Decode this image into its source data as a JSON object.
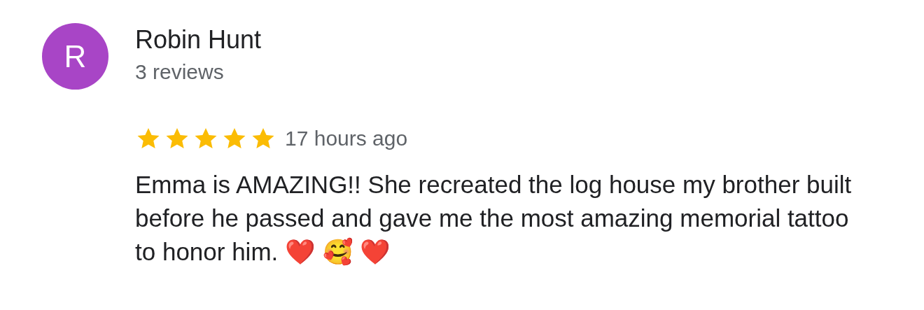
{
  "review": {
    "avatar_letter": "R",
    "author": "Robin Hunt",
    "review_count": "3 reviews",
    "stars": 5,
    "time": "17 hours ago",
    "text": "Emma is AMAZING!! She recreated the log house my brother built before he passed and gave me the most amazing memorial tattoo to honor him. ❤️ 🥰 ❤️"
  }
}
